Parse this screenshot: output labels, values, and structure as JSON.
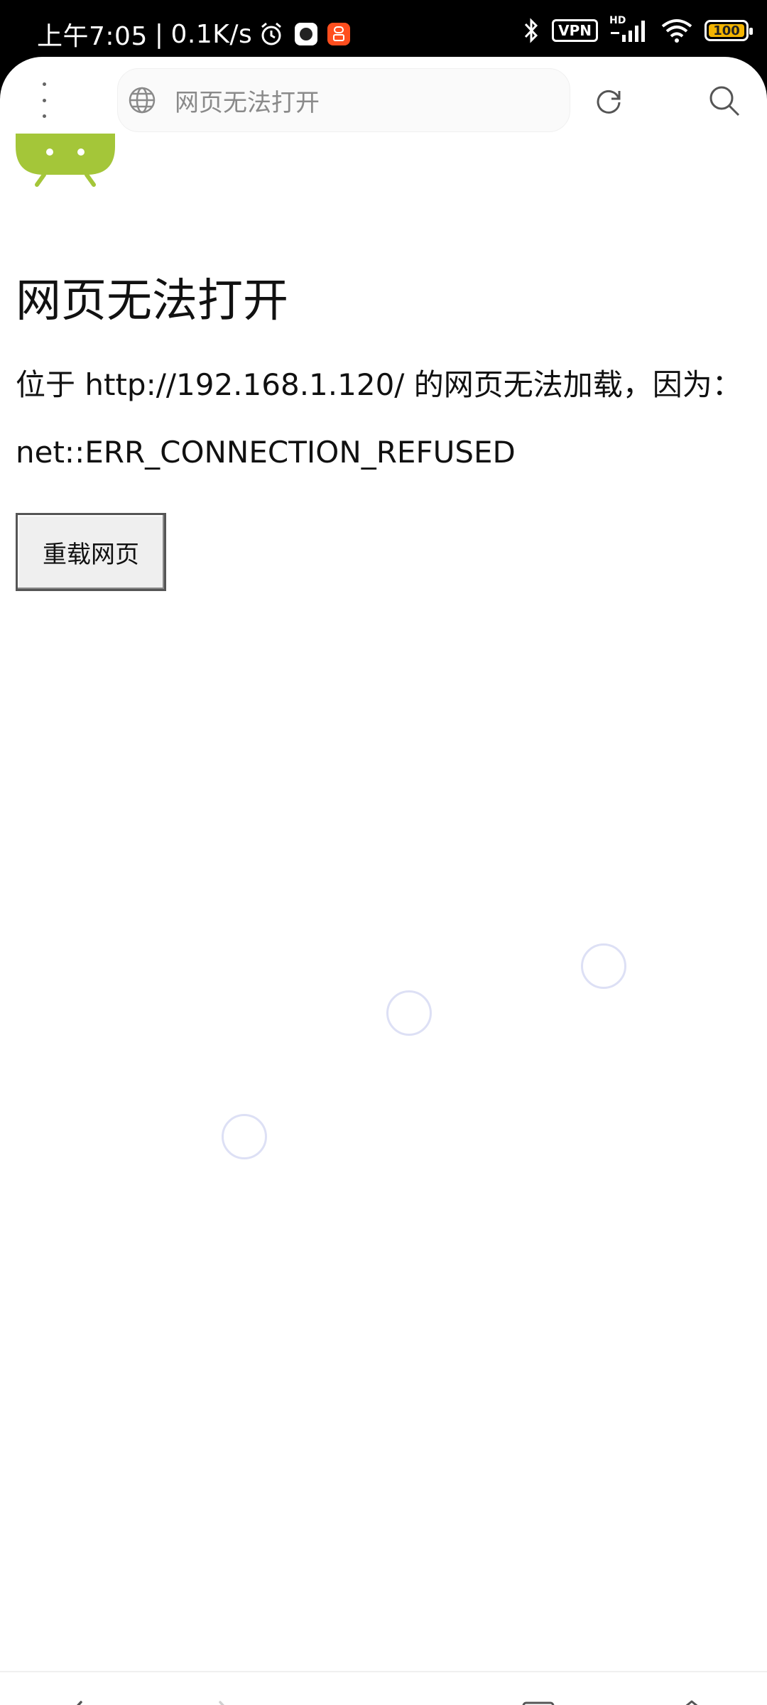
{
  "status_bar": {
    "time": "上午7:05",
    "net_speed": "0.1K/s",
    "vpn": "VPN",
    "hd": "HD",
    "battery": "100",
    "battery_level": 1.0
  },
  "toolbar": {
    "url_text": "网页无法打开"
  },
  "page": {
    "title": "网页无法打开",
    "message": "位于 http://192.168.1.120/ 的网页无法加载，因为：",
    "error_code": "net::ERR_CONNECTION_REFUSED",
    "reload_label": "重载网页"
  },
  "colors": {
    "android_green": "#a4c639",
    "ring": "#dde0f5",
    "battery": "#f3b400"
  },
  "icons": {
    "menu": "more-vertical-icon",
    "globe": "globe-icon",
    "reload": "reload-icon",
    "search": "search-icon",
    "back": "chevron-left-icon",
    "forward": "chevron-right-icon",
    "tabs_menu": "hamburger-icon",
    "windows": "square-icon",
    "home": "home-icon"
  }
}
